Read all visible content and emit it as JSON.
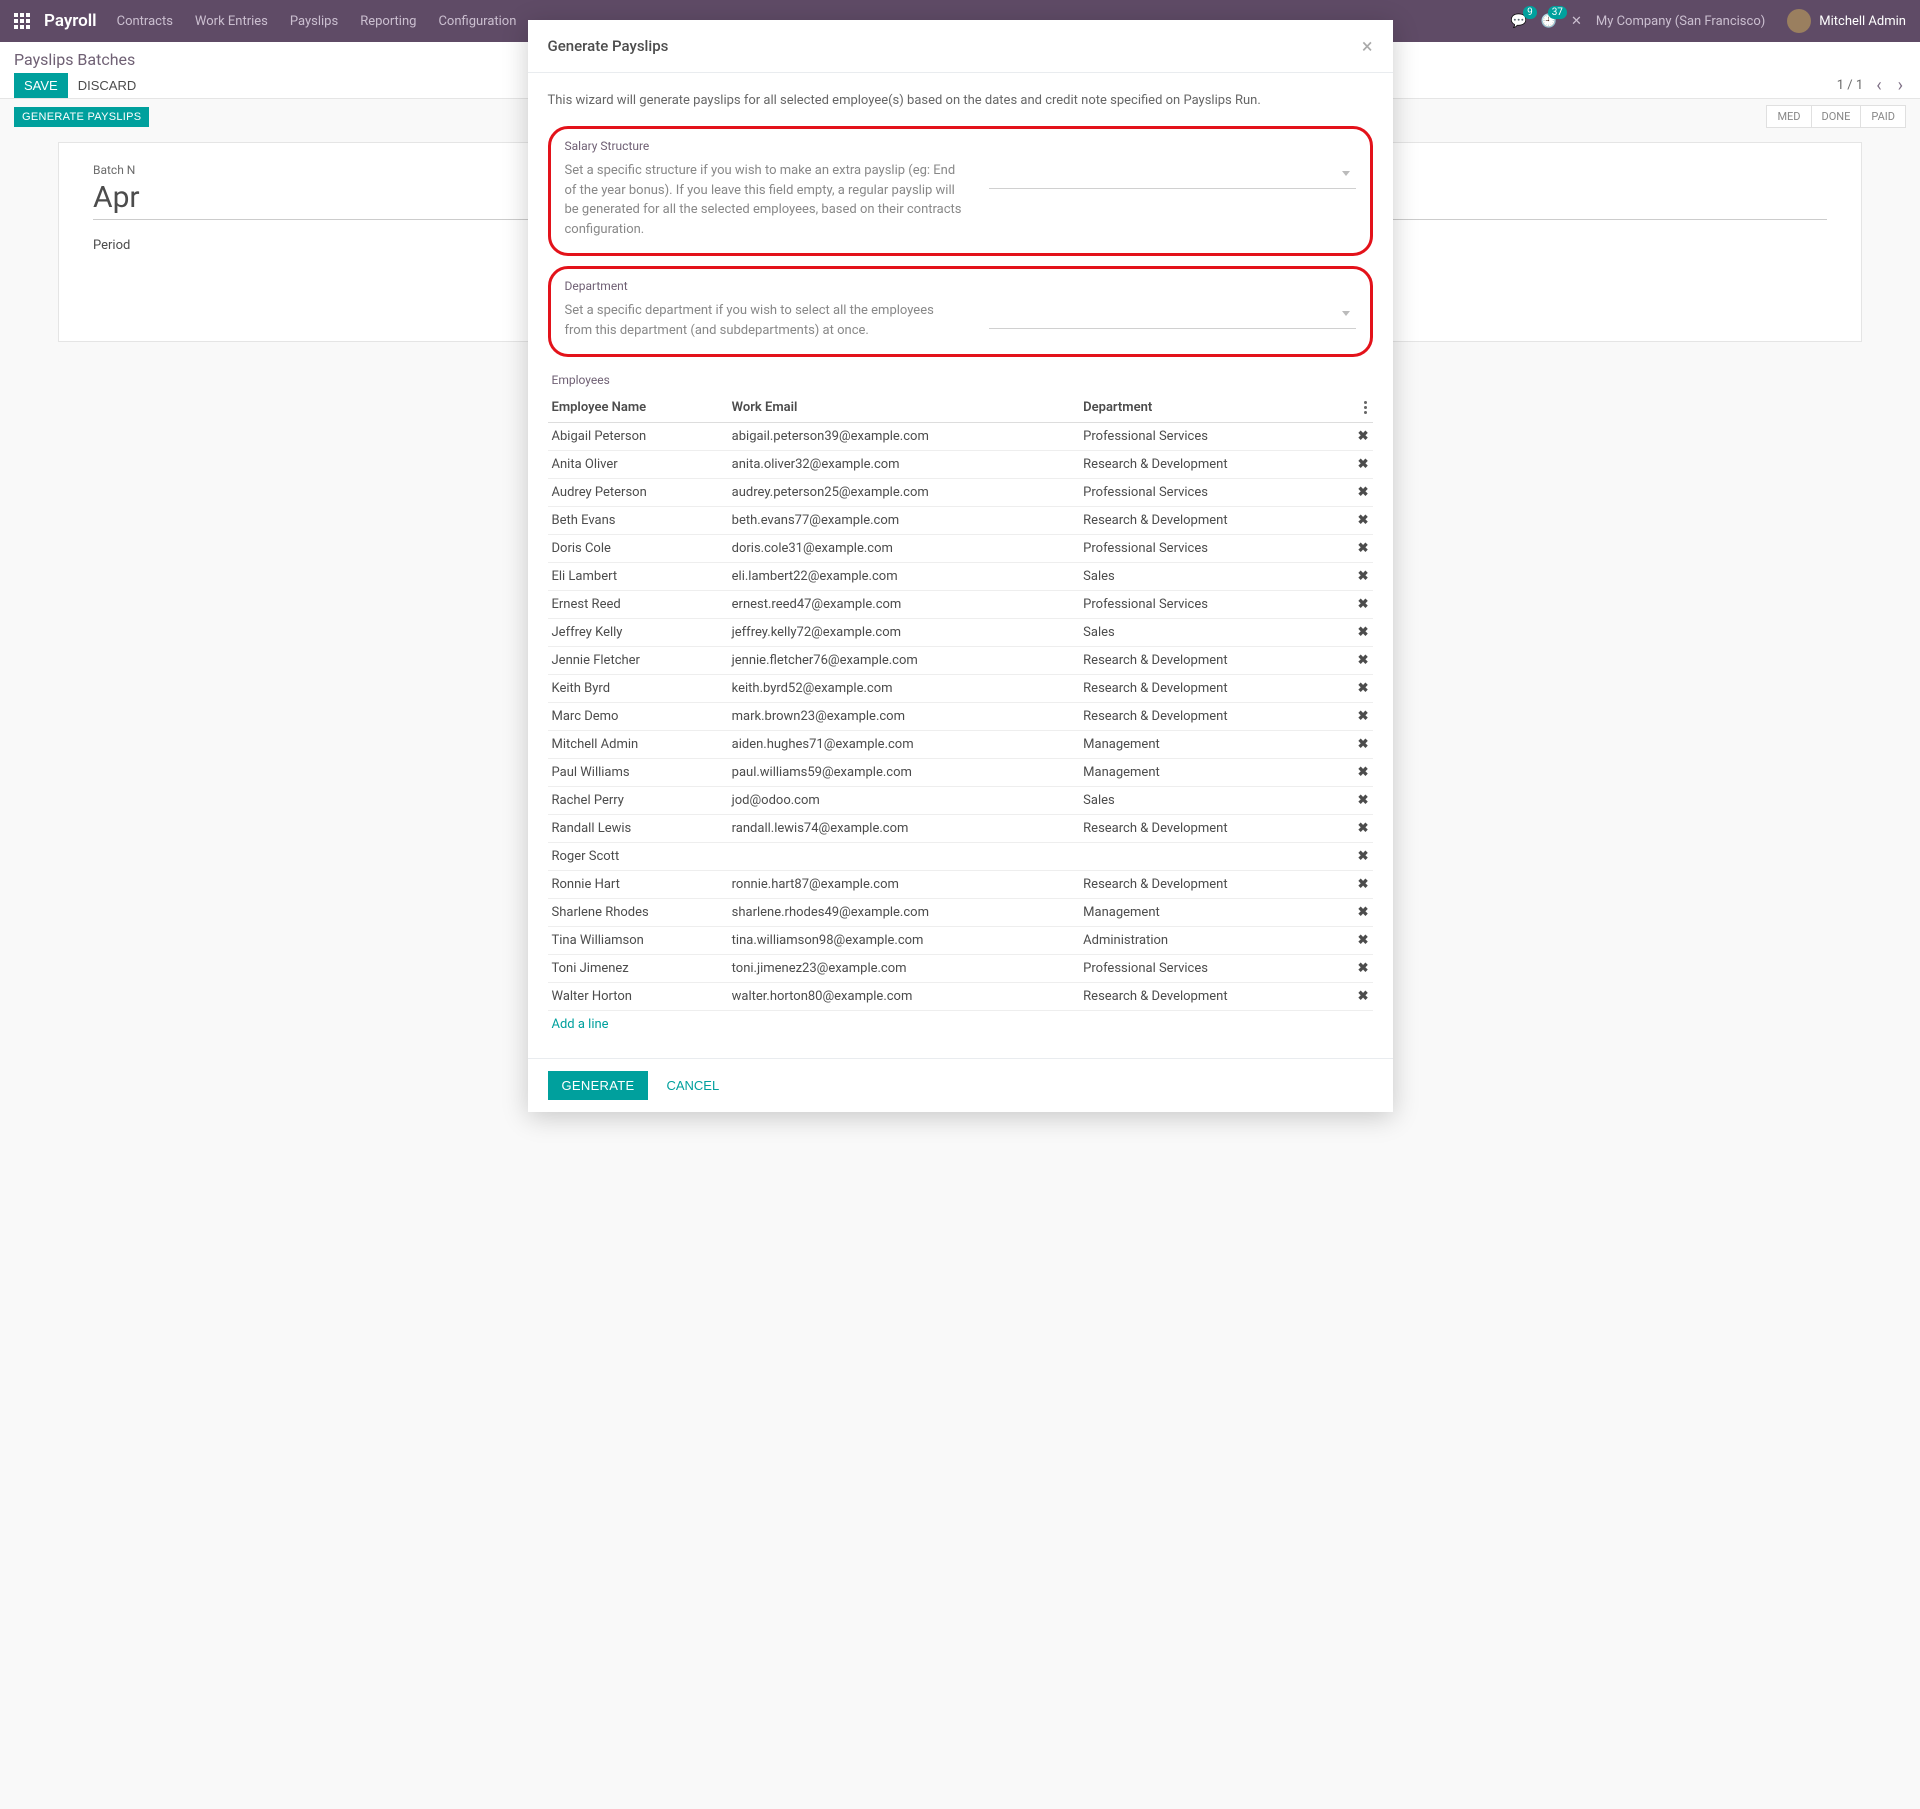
{
  "topnav": {
    "brand": "Payroll",
    "menu": [
      "Contracts",
      "Work Entries",
      "Payslips",
      "Reporting",
      "Configuration"
    ],
    "badge1": "9",
    "badge2": "37",
    "company": "My Company (San Francisco)",
    "user": "Mitchell Admin"
  },
  "controlbar": {
    "title": "Payslips Batches",
    "save": "SAVE",
    "discard": "DISCARD",
    "pager": "1 / 1"
  },
  "statusstrip": {
    "generate": "GENERATE PAYSLIPS",
    "steps": [
      "MED",
      "DONE",
      "PAID"
    ]
  },
  "form": {
    "batch_label": "Batch N",
    "batch_value": "Apr",
    "period_label": "Period"
  },
  "modal": {
    "title": "Generate Payslips",
    "intro": "This wizard will generate payslips for all selected employee(s) based on the dates and credit note specified on Payslips Run.",
    "salary_title": "Salary Structure",
    "salary_help": "Set a specific structure if you wish to make an extra payslip (eg: End of the year bonus). If you leave this field empty, a regular payslip will be generated for all the selected employees, based on their contracts configuration.",
    "dept_title": "Department",
    "dept_help": "Set a specific department if you wish to select all the employees from this department (and subdepartments) at once.",
    "employees_title": "Employees",
    "col_name": "Employee Name",
    "col_email": "Work Email",
    "col_dept": "Department",
    "add_line": "Add a line",
    "generate_btn": "GENERATE",
    "cancel_btn": "CANCEL",
    "employees": [
      {
        "name": "Abigail Peterson",
        "email": "abigail.peterson39@example.com",
        "dept": "Professional Services"
      },
      {
        "name": "Anita Oliver",
        "email": "anita.oliver32@example.com",
        "dept": "Research & Development"
      },
      {
        "name": "Audrey Peterson",
        "email": "audrey.peterson25@example.com",
        "dept": "Professional Services"
      },
      {
        "name": "Beth Evans",
        "email": "beth.evans77@example.com",
        "dept": "Research & Development"
      },
      {
        "name": "Doris Cole",
        "email": "doris.cole31@example.com",
        "dept": "Professional Services"
      },
      {
        "name": "Eli Lambert",
        "email": "eli.lambert22@example.com",
        "dept": "Sales"
      },
      {
        "name": "Ernest Reed",
        "email": "ernest.reed47@example.com",
        "dept": "Professional Services"
      },
      {
        "name": "Jeffrey Kelly",
        "email": "jeffrey.kelly72@example.com",
        "dept": "Sales"
      },
      {
        "name": "Jennie Fletcher",
        "email": "jennie.fletcher76@example.com",
        "dept": "Research & Development"
      },
      {
        "name": "Keith Byrd",
        "email": "keith.byrd52@example.com",
        "dept": "Research & Development"
      },
      {
        "name": "Marc Demo",
        "email": "mark.brown23@example.com",
        "dept": "Research & Development"
      },
      {
        "name": "Mitchell Admin",
        "email": "aiden.hughes71@example.com",
        "dept": "Management"
      },
      {
        "name": "Paul Williams",
        "email": "paul.williams59@example.com",
        "dept": "Management"
      },
      {
        "name": "Rachel Perry",
        "email": "jod@odoo.com",
        "dept": "Sales"
      },
      {
        "name": "Randall Lewis",
        "email": "randall.lewis74@example.com",
        "dept": "Research & Development"
      },
      {
        "name": "Roger Scott",
        "email": "",
        "dept": ""
      },
      {
        "name": "Ronnie Hart",
        "email": "ronnie.hart87@example.com",
        "dept": "Research & Development"
      },
      {
        "name": "Sharlene Rhodes",
        "email": "sharlene.rhodes49@example.com",
        "dept": "Management"
      },
      {
        "name": "Tina Williamson",
        "email": "tina.williamson98@example.com",
        "dept": "Administration"
      },
      {
        "name": "Toni Jimenez",
        "email": "toni.jimenez23@example.com",
        "dept": "Professional Services"
      },
      {
        "name": "Walter Horton",
        "email": "walter.horton80@example.com",
        "dept": "Research & Development"
      }
    ]
  }
}
